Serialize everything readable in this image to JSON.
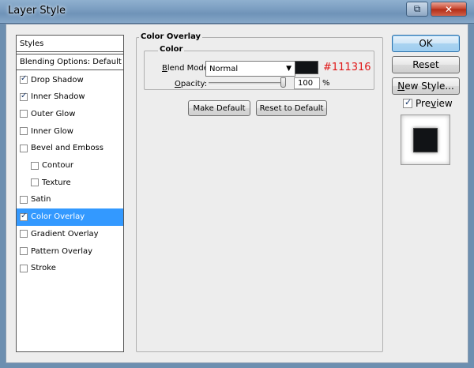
{
  "window": {
    "title": "Layer Style",
    "help_glyph": "⧉",
    "close_glyph": "✕"
  },
  "styles_panel": {
    "header": "Styles",
    "blending_options": "Blending Options: Default",
    "items": [
      {
        "label": "Drop Shadow",
        "checked": true,
        "indent": false,
        "selected": false
      },
      {
        "label": "Inner Shadow",
        "checked": true,
        "indent": false,
        "selected": false
      },
      {
        "label": "Outer Glow",
        "checked": false,
        "indent": false,
        "selected": false
      },
      {
        "label": "Inner Glow",
        "checked": false,
        "indent": false,
        "selected": false
      },
      {
        "label": "Bevel and Emboss",
        "checked": false,
        "indent": false,
        "selected": false
      },
      {
        "label": "Contour",
        "checked": false,
        "indent": true,
        "selected": false
      },
      {
        "label": "Texture",
        "checked": false,
        "indent": true,
        "selected": false
      },
      {
        "label": "Satin",
        "checked": false,
        "indent": false,
        "selected": false
      },
      {
        "label": "Color Overlay",
        "checked": true,
        "indent": false,
        "selected": true
      },
      {
        "label": "Gradient Overlay",
        "checked": false,
        "indent": false,
        "selected": false
      },
      {
        "label": "Pattern Overlay",
        "checked": false,
        "indent": false,
        "selected": false
      },
      {
        "label": "Stroke",
        "checked": false,
        "indent": false,
        "selected": false
      }
    ]
  },
  "color_overlay": {
    "group_title": "Color Overlay",
    "color_group_title": "Color",
    "blend_mode_label_u": "B",
    "blend_mode_label_rest": "lend Mode:",
    "blend_mode_value": "Normal",
    "blend_arrow": "▼",
    "swatch_color": "#111316",
    "hex_annotation": "#111316",
    "opacity_label_u": "O",
    "opacity_label_rest": "pacity:",
    "opacity_value": "100",
    "opacity_level": 1.0,
    "percent_sign": "%",
    "make_default_label": "Make Default",
    "reset_to_default_label": "Reset to Default"
  },
  "actions": {
    "ok_label": "OK",
    "reset_label": "Reset",
    "new_style_label_u": "N",
    "new_style_label_rest": "ew Style...",
    "preview_label_u": "v",
    "preview_label_pre": "Pre",
    "preview_label_post": "iew",
    "preview_checked": true
  },
  "colors": {
    "selection_blue": "#3399ff",
    "overlay_color": "#111316",
    "annotation_red": "#e01616"
  }
}
